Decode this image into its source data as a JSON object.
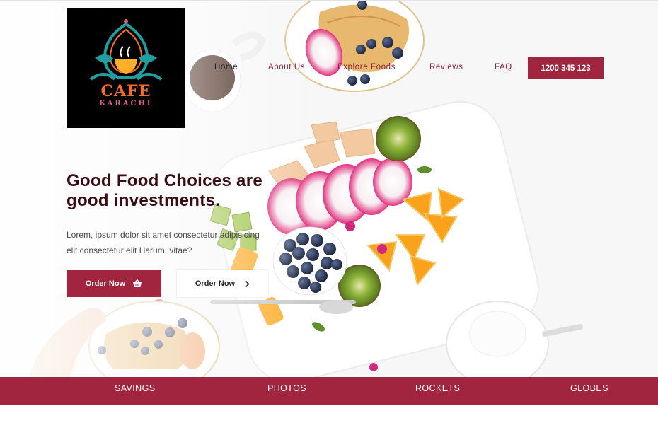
{
  "brand": {
    "logo_word": "CAFE",
    "logo_city": "KARACHI",
    "colors": {
      "accent": "#a2253f",
      "title": "#3b0b14",
      "logo_orange": "#ef6f2a",
      "logo_pink": "#e45b8e"
    }
  },
  "nav": {
    "items": [
      {
        "label": "Home",
        "active": true
      },
      {
        "label": "About Us",
        "active": false
      },
      {
        "label": "Explore Foods",
        "active": false
      },
      {
        "label": "Reviews",
        "active": false
      },
      {
        "label": "FAQ",
        "active": false
      }
    ],
    "phone": "1200 345 123"
  },
  "hero": {
    "title_line1": "Good Food Choices are",
    "title_line2": "good investments.",
    "text_line1": "Lorem, ipsum dolor sit amet consectetur adipisicing",
    "text_line2": "elit.consectetur elit Harum, vitae?",
    "primary_button": {
      "label": "Order Now",
      "icon": "shopping-basket-icon"
    },
    "secondary_button": {
      "label": "Order Now",
      "icon": "chevron-right-icon"
    }
  },
  "bottom_bar": {
    "items": [
      "SAVINGS",
      "PHOTOS",
      "ROCKETS",
      "GLOBES"
    ]
  }
}
